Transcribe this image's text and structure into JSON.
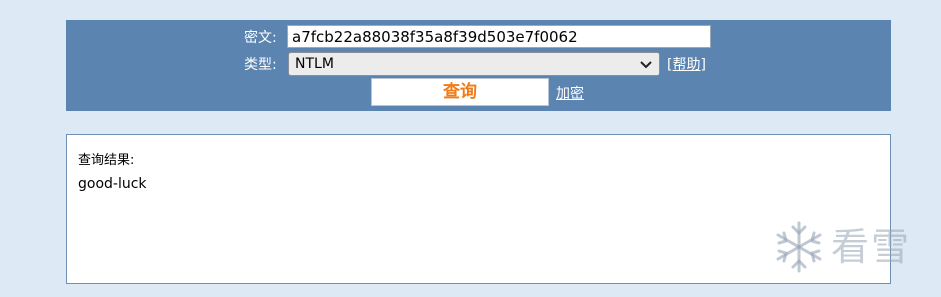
{
  "form": {
    "cipher_label": "密文:",
    "cipher_value": "a7fcb22a88038f35a8f39d503e7f0062",
    "type_label": "类型:",
    "type_selected": "NTLM",
    "help_link": "[帮助]",
    "query_button": "查询",
    "encrypt_link": "加密"
  },
  "result": {
    "title": "查询结果:",
    "value": "good-luck"
  },
  "watermark": {
    "brand": "看雪",
    "icon": "snowflake-icon"
  },
  "colors": {
    "page_background": "#dde9f4",
    "panel_blue": "#5b84b1",
    "query_text": "#f07b18"
  }
}
